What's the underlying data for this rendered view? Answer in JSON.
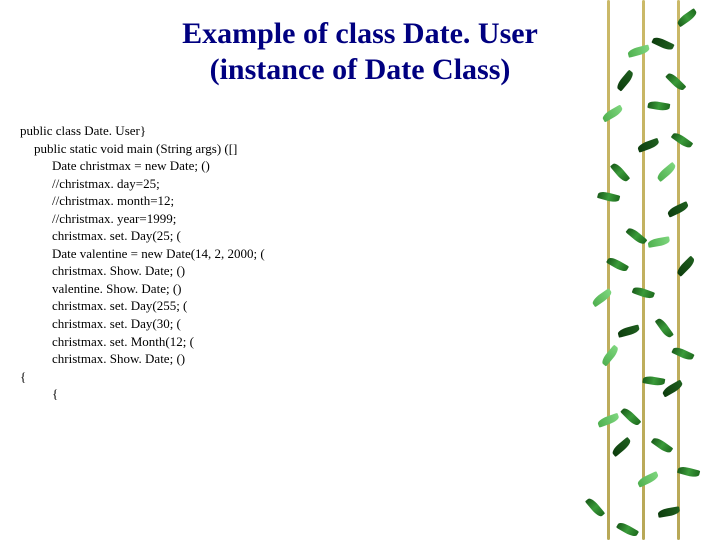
{
  "title_line1": "Example of class Date. User",
  "title_line2": "(instance of Date Class)",
  "code": {
    "l0": "public class Date. User}",
    "l1": "public static void main (String args) ([]",
    "l2": "Date christmax = new Date; ()",
    "l3": "//christmax. day=25;",
    "l4": "//christmax. month=12;",
    "l5": "//christmax. year=1999;",
    "l6": "christmax. set. Day(25; (",
    "l7": "Date valentine = new Date(14, 2, 2000; (",
    "l8": "christmax. Show. Date; ()",
    "l9": "valentine. Show. Date; ()",
    "l10": "christmax. set. Day(255; (",
    "l11": "christmax. set. Day(30; (",
    "l12": "christmax. set. Month(12; (",
    "l13": "christmax. Show. Date; ()",
    "l14": "{",
    "l15": "{"
  }
}
